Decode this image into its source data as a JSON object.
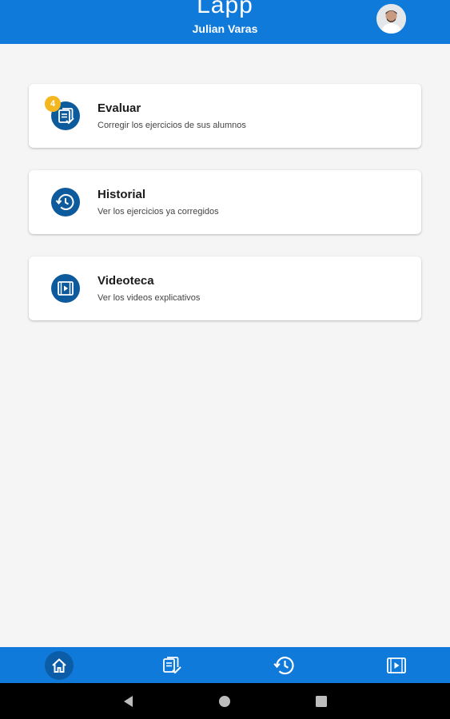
{
  "header": {
    "app_title": "Lapp",
    "user_name": "Julian Varas",
    "avatar_icon": "user-avatar"
  },
  "menu": [
    {
      "title": "Evaluar",
      "subtitle": "Corregir los ejercicios de sus alumnos",
      "icon": "evaluate-icon",
      "badge": "4"
    },
    {
      "title": "Historial",
      "subtitle": "Ver los ejercicios ya corregidos",
      "icon": "history-icon"
    },
    {
      "title": "Videoteca",
      "subtitle": "Ver los videos explicativos",
      "icon": "video-library-icon"
    }
  ],
  "bottom_nav": [
    {
      "icon": "home-icon",
      "active": true
    },
    {
      "icon": "evaluate-icon",
      "active": false
    },
    {
      "icon": "history-icon",
      "active": false
    },
    {
      "icon": "video-library-icon",
      "active": false
    }
  ],
  "system_nav": [
    "back-icon",
    "home-circle-icon",
    "recents-icon"
  ],
  "colors": {
    "primary": "#0f7ad9",
    "icon_bg": "#0d5a9c",
    "badge": "#f5b720",
    "background": "#f5f5f5"
  }
}
